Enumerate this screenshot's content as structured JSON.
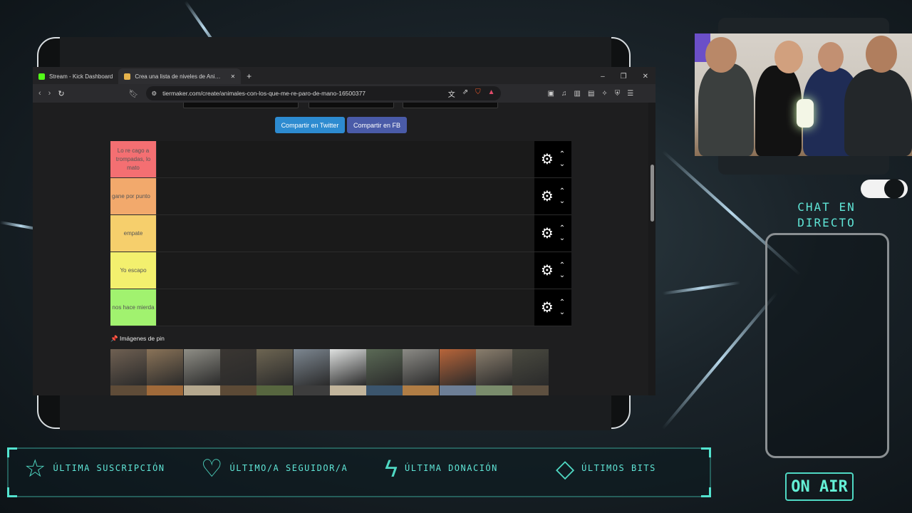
{
  "browser": {
    "tabs": [
      {
        "label": "Stream - Kick Dashboard",
        "favicon_color": "#53fc18",
        "active": false
      },
      {
        "label": "Crea una lista de niveles de Ani…",
        "favicon_color": "#e6b34c",
        "active": true
      }
    ],
    "new_tab_icon": "plus-icon",
    "window_controls": {
      "minimize": "–",
      "maximize": "❐",
      "close": "✕"
    },
    "url": "tiermaker.com/create/animales-con-los-que-me-re-paro-de-mano-16500377",
    "icons": [
      "back-arrow-icon",
      "forward-arrow-icon",
      "reload-icon",
      "bookmark-icon",
      "site-settings-icon",
      "translate-icon",
      "share-icon",
      "brave-shield-icon",
      "rewards-icon"
    ]
  },
  "page": {
    "share_twitter": "Compartir en Twitter",
    "share_fb": "Compartir en FB",
    "share_twitter_color": "#2d8bd0",
    "share_fb_color": "#4a5ba8",
    "tiers": [
      {
        "label": "Lo re cago a trompadas, lo mato",
        "color": "#f46f72"
      },
      {
        "label": "gane por punto",
        "color": "#f2a96c"
      },
      {
        "label": "empate",
        "color": "#f6cf6c"
      },
      {
        "label": "Yo escapo",
        "color": "#f3f06e"
      },
      {
        "label": "nos hace mierda",
        "color": "#a1f26f"
      }
    ],
    "pin_icon": "📌",
    "pin_title": "Imágenes de pin",
    "gallery": [
      "capybara",
      "crocodile",
      "alligator",
      "bull",
      "kangaroo",
      "walrus",
      "polar-bear",
      "sea-turtle",
      "wolf",
      "fox",
      "elephant",
      "chimpanzee"
    ],
    "gallery_colors": [
      "#6f6052",
      "#8a7358",
      "#8f8e86",
      "#3a3632",
      "#6d6552",
      "#7d8791",
      "#dfe1e0",
      "#5b6a56",
      "#8c8b86",
      "#b8653a",
      "#8a7e6d",
      "#4a4a40"
    ],
    "gallery_row2_colors": [
      "#5f4c38",
      "#a06a3a",
      "#b5a88e",
      "#5c4a36",
      "#57663f",
      "#3d3d3d",
      "#c2b59c",
      "#3b556d",
      "#b07d45",
      "#6d7e96",
      "#7a8c6c",
      "#5e5040"
    ]
  },
  "overlay": {
    "chat_title_line1": "CHAT EN",
    "chat_title_line2": "DIRECTO",
    "on_air": "ON AIR",
    "accent": "#4fd8c3",
    "bottom": [
      {
        "icon": "star-icon",
        "glyph": "☆",
        "label": "ÚLTIMA SUSCRIPCIÓN"
      },
      {
        "icon": "heart-icon",
        "glyph": "♡",
        "label": "ÚLTIMO/A SEGUIDOR/A"
      },
      {
        "icon": "lightning-icon",
        "glyph": "ϟ",
        "label": "ÚLTIMA DONACIÓN"
      },
      {
        "icon": "diamond-icon",
        "glyph": "◇",
        "label": "ÚLTIMOS BITS"
      }
    ]
  }
}
